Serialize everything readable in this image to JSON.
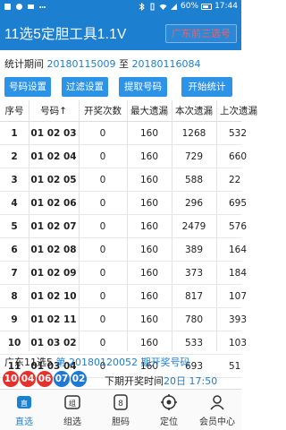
{
  "status_bar": {
    "time": "17:44",
    "battery": "60%"
  },
  "app_bar": {
    "title": "11选5定胆工具1.1V",
    "region_button": "广东前三选号"
  },
  "period": {
    "label": "统计期间",
    "start": "20180115009",
    "to": "至",
    "end": "20180116084"
  },
  "buttons": [
    "号码设置",
    "过滤设置",
    "提取号码",
    "开始统计"
  ],
  "table": {
    "headers": [
      "序号",
      "号码↑",
      "开奖次数",
      "最大遗漏",
      "本次遗漏",
      "上次遗漏"
    ],
    "rows": [
      [
        "1",
        "01 02 03",
        "0",
        "160",
        "1268",
        "532"
      ],
      [
        "2",
        "01 02 04",
        "0",
        "160",
        "729",
        "660"
      ],
      [
        "3",
        "01 02 05",
        "0",
        "160",
        "588",
        "22"
      ],
      [
        "4",
        "01 02 06",
        "0",
        "160",
        "296",
        "695"
      ],
      [
        "5",
        "01 02 07",
        "0",
        "160",
        "2479",
        "576"
      ],
      [
        "6",
        "01 02 08",
        "0",
        "160",
        "389",
        "164"
      ],
      [
        "7",
        "01 02 09",
        "0",
        "160",
        "373",
        "184"
      ],
      [
        "8",
        "01 02 10",
        "0",
        "160",
        "817",
        "107"
      ],
      [
        "9",
        "01 02 11",
        "0",
        "160",
        "780",
        "393"
      ],
      [
        "10",
        "01 03 02",
        "0",
        "160",
        "533",
        "103"
      ],
      [
        "11",
        "01 03 04",
        "0",
        "160",
        "693",
        "51"
      ]
    ]
  },
  "draw_info": {
    "lottery": "广东11选5",
    "issue_prefix": "第",
    "issue": "20180120052",
    "issue_suffix": "期开奖号码"
  },
  "draw_balls": [
    {
      "n": "10",
      "color": "red"
    },
    {
      "n": "04",
      "color": "red"
    },
    {
      "n": "06",
      "color": "red"
    },
    {
      "n": "07",
      "color": "blue"
    },
    {
      "n": "02",
      "color": "blue"
    }
  ],
  "next_draw": {
    "label": "下期开奖时间",
    "date": "20日",
    "time": "17:50"
  },
  "tabs": [
    {
      "label": "直选",
      "icon": "direct-select-icon",
      "active": true
    },
    {
      "label": "组选",
      "icon": "group-select-icon",
      "active": false
    },
    {
      "label": "胆码",
      "icon": "banker-number-icon",
      "active": false
    },
    {
      "label": "定位",
      "icon": "location-icon",
      "active": false
    },
    {
      "label": "会员中心",
      "icon": "member-icon",
      "active": false
    }
  ]
}
